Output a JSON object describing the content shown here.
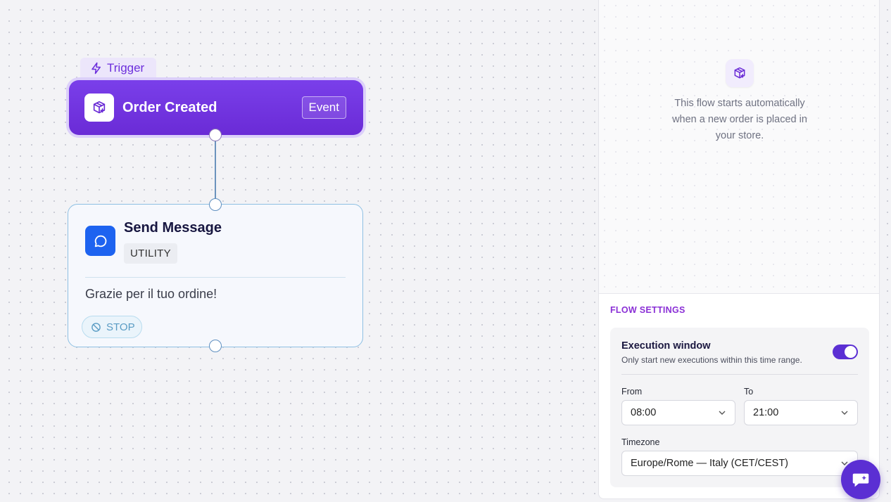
{
  "canvas": {
    "trigger_tab": {
      "label": "Trigger",
      "icon": "bolt-icon"
    },
    "trigger_node": {
      "title": "Order Created",
      "badge": "Event",
      "icon": "package-plus-icon"
    },
    "message_node": {
      "title": "Send Message",
      "category": "UTILITY",
      "body": "Grazie per il tuo ordine!",
      "stop_label": "STOP",
      "icon": "message-bubble-icon",
      "stop_icon": "ban-icon"
    }
  },
  "panel": {
    "description": "This flow starts automatically when a new order is placed in your store.",
    "icon": "package-plus-icon",
    "settings": {
      "heading": "FLOW SETTINGS",
      "execution_window": {
        "title": "Execution window",
        "subtitle": "Only start new executions within this time range.",
        "enabled": true
      },
      "from": {
        "label": "From",
        "value": "08:00"
      },
      "to": {
        "label": "To",
        "value": "21:00"
      },
      "timezone": {
        "label": "Timezone",
        "value": "Europe/Rome — Italy (CET/CEST)"
      }
    }
  },
  "colors": {
    "accent": "#6a2bd6",
    "message_blue": "#1d63f0",
    "settings_heading": "#8a2fd6",
    "toggle_on": "#5b2fd3"
  },
  "chat_fab": {
    "icon": "chat-sparkle-icon"
  }
}
